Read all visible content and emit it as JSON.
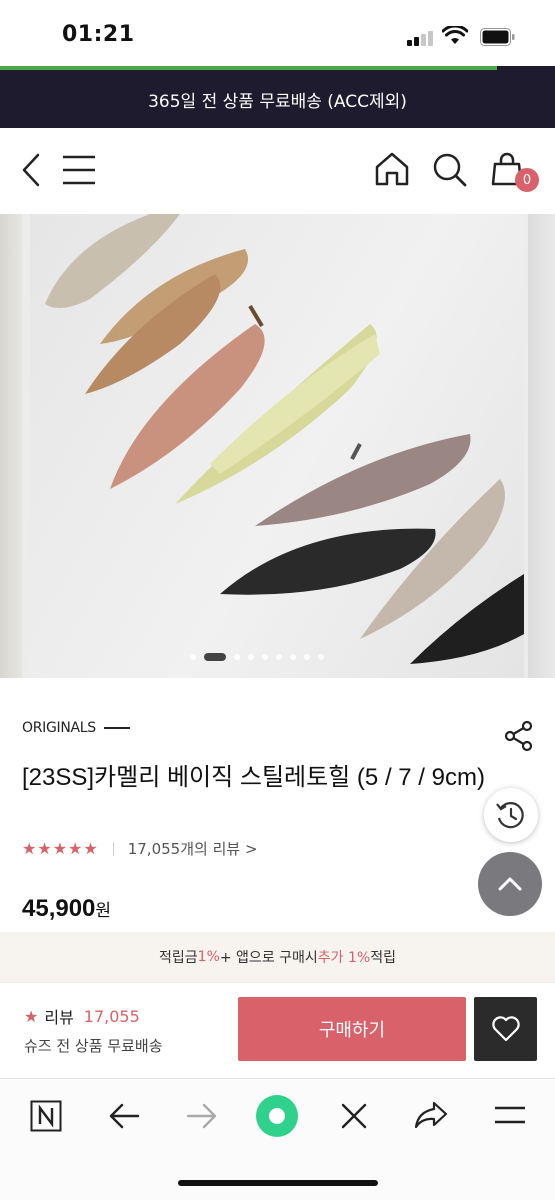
{
  "status_bar": {
    "time": "01:21"
  },
  "banner": {
    "text": "365일 전 상품 무료배송 (ACC제외)"
  },
  "header": {
    "cart_count": "0"
  },
  "product": {
    "brand": "ORIGINALS",
    "title": "[23SS]카멜리 베이직 스틸레토힐 (5 / 7 / 9cm)",
    "rating_stars": "★★★★★",
    "review_link": "17,055개의 리뷰 >",
    "price_value": "45,900",
    "price_unit": "원"
  },
  "points": {
    "prefix": "적립금 ",
    "rate1": "1%",
    "middle": " + 앱으로 구매시 ",
    "extra": "추가 1%",
    "suffix": "적립"
  },
  "purchase_bar": {
    "review_label": "리뷰",
    "review_count": "17,055",
    "shipping": "슈즈 전 상품 무료배송",
    "buy_label": "구매하기"
  },
  "colors": {
    "accent": "#d9626a",
    "banner_bg": "#1e1b2e",
    "progress": "#4ca64c"
  }
}
